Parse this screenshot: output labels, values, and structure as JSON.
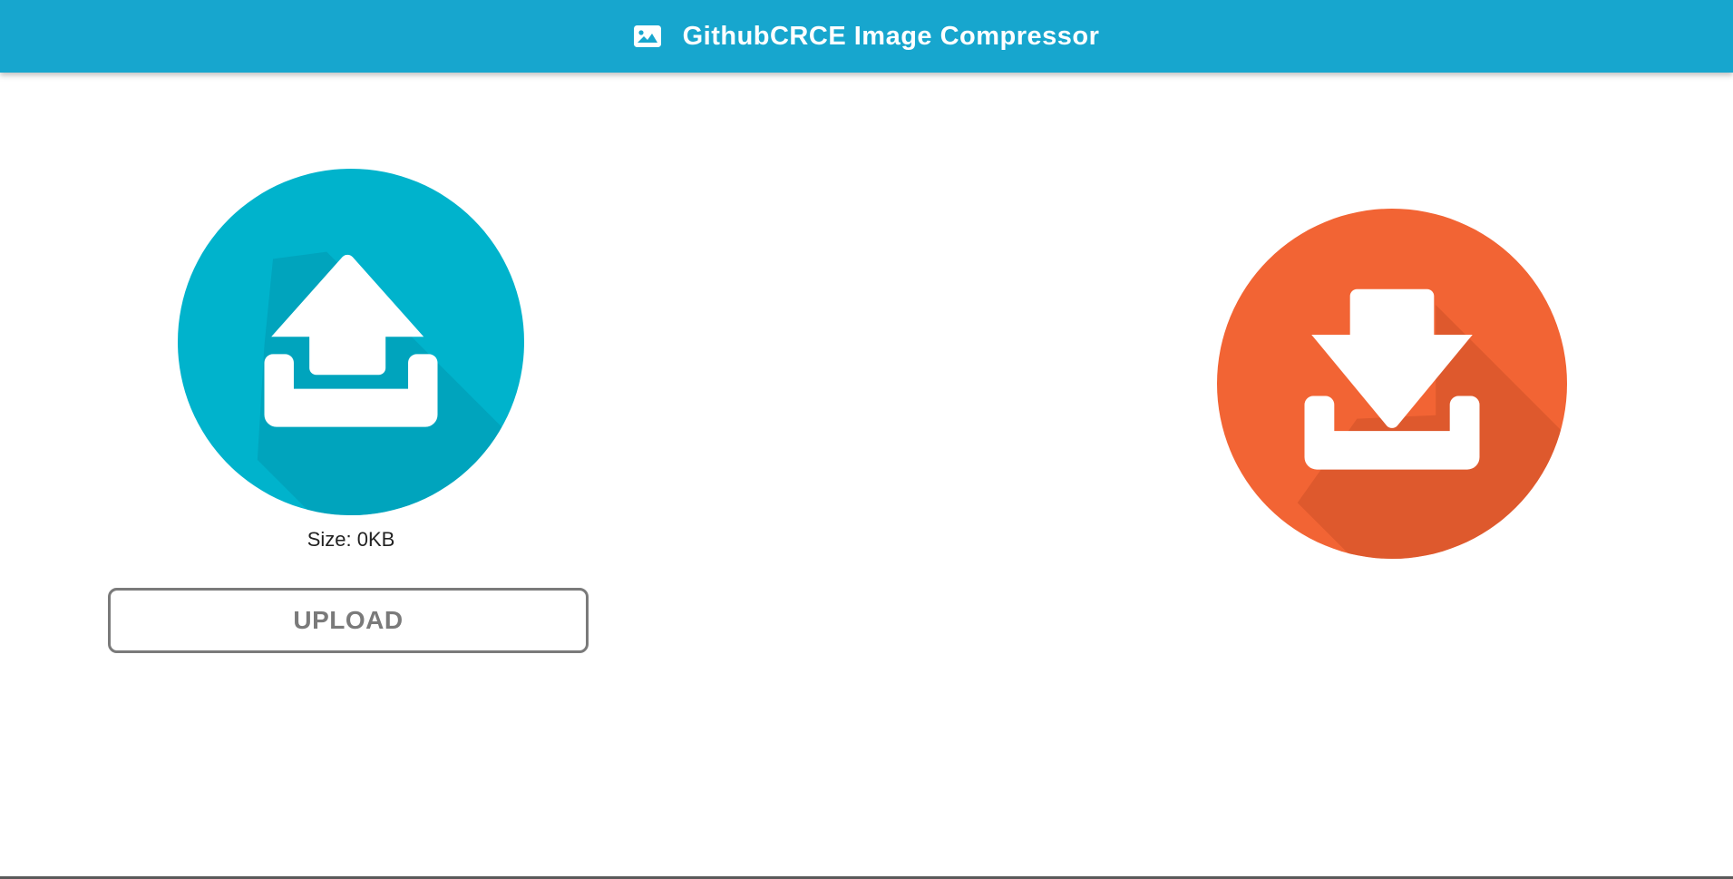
{
  "header": {
    "title": "GithubCRCE Image Compressor",
    "icon": "image-icon",
    "background_color": "#17a6ce"
  },
  "upload_panel": {
    "icon": "upload-icon",
    "circle_color": "#00b3cc",
    "size_label": "Size: 0KB",
    "button_label": "UPLOAD"
  },
  "download_panel": {
    "icon": "download-icon",
    "circle_color": "#f26434"
  }
}
